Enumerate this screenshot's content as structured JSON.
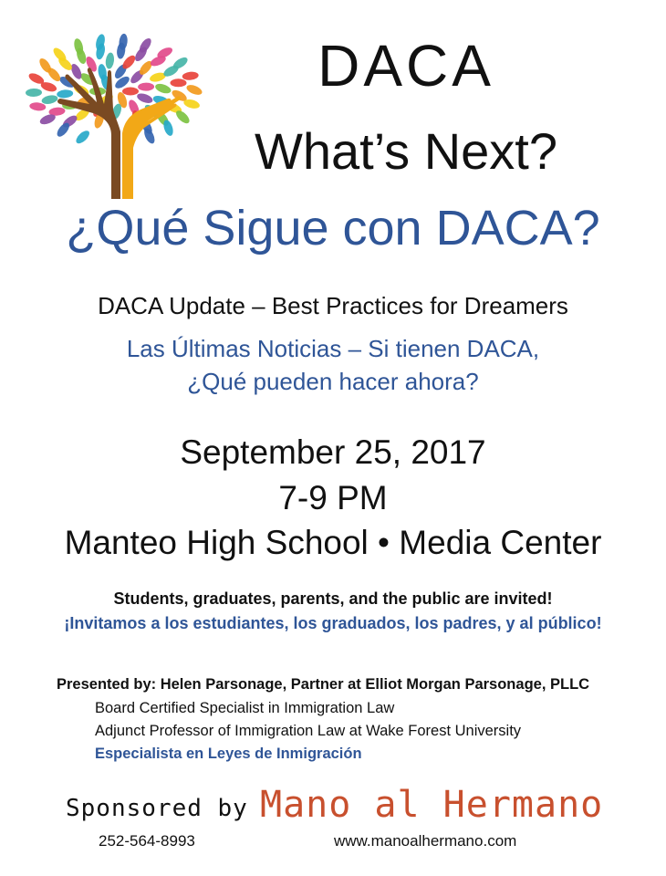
{
  "logo": {
    "icon": "tree-hands-icon",
    "colors": {
      "trunk_left": "#7a4a22",
      "trunk_right": "#f2a817",
      "leaves": [
        "#e8433b",
        "#f29a1d",
        "#f5d31a",
        "#7dc242",
        "#27a9c9",
        "#3565b0",
        "#8b4da3",
        "#e24a8b",
        "#46b5a8"
      ]
    }
  },
  "header": {
    "title": "DACA",
    "subtitle": "What’s Next?",
    "title_es": "¿Qué Sigue con DACA?"
  },
  "description": {
    "en": "DACA Update – Best Practices for Dreamers",
    "es_line1": "Las Últimas Noticias – Si tienen DACA,",
    "es_line2": "¿Qué pueden hacer ahora?"
  },
  "event": {
    "date": "September 25, 2017",
    "time": "7-9 PM",
    "location": "Manteo High School • Media Center"
  },
  "invitation": {
    "en": "Students, graduates, parents, and the public are invited!",
    "es": "¡Invitamos a los estudiantes, los graduados, los padres, y al público!"
  },
  "presenter": {
    "line": "Presented by: Helen Parsonage, Partner at Elliot Morgan Parsonage, PLLC",
    "credential_1": "Board Certified Specialist in Immigration Law",
    "credential_2": "Adjunct Professor of Immigration Law at Wake Forest University",
    "credential_es": "Especialista en Leyes de Inmigración"
  },
  "sponsor": {
    "label": "Sponsored by",
    "name": "Mano al Hermano",
    "phone": "252-564-8993",
    "website": "www.manoalhermano.com"
  },
  "colors": {
    "accent_blue": "#2f5597",
    "sponsor_orange": "#c8502e",
    "text": "#111111"
  }
}
